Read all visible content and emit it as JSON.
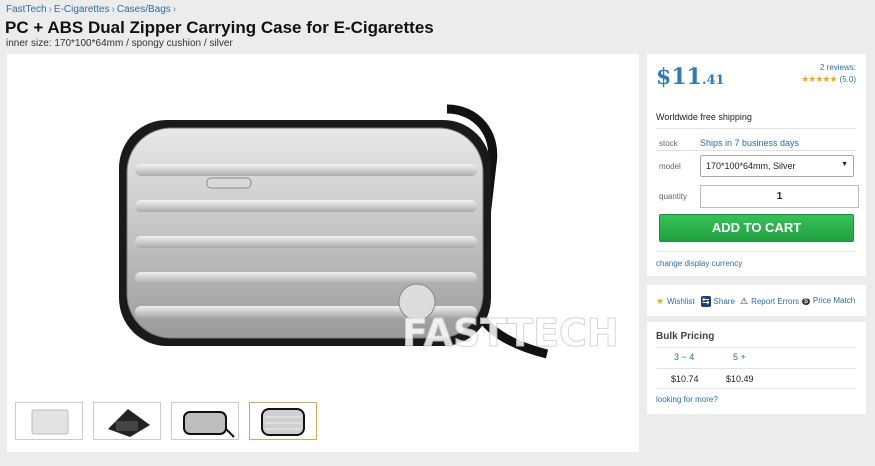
{
  "breadcrumb": [
    "FastTech",
    "E-Cigarettes",
    "Cases/Bags"
  ],
  "breadcrumb_sep": "›",
  "product": {
    "title": "PC + ABS Dual Zipper Carrying Case for E-Cigarettes",
    "subtitle": "inner size: 170*100*64mm / spongy cushion / silver",
    "watermark": "FASTTECH"
  },
  "price": {
    "currency": "$",
    "integer": "11",
    "decimal": ".41"
  },
  "reviews": {
    "label": "2 reviews:",
    "stars": "★★★★★",
    "rating": "(5.0)"
  },
  "shipping": "Worldwide free shipping",
  "stock": {
    "label": "stock",
    "value": "Ships in 7 business days"
  },
  "model": {
    "label": "model",
    "selected": "170*100*64mm, Silver",
    "arrow": "▼"
  },
  "quantity": {
    "label": "quantity",
    "value": "1"
  },
  "add_to_cart": "ADD TO CART",
  "currency_link": "change display currency",
  "actions": [
    {
      "icon": "★",
      "label": "Wishlist"
    },
    {
      "icon": "⇆",
      "label": "Share"
    },
    {
      "icon": "⚠",
      "label": "Report Errors"
    },
    {
      "icon": "$",
      "label": "Price Match"
    }
  ],
  "bulk": {
    "title": "Bulk Pricing",
    "tiers": [
      {
        "qty": "3 ~ 4",
        "price": "$10.74"
      },
      {
        "qty": "5 +",
        "price": "$10.49"
      }
    ],
    "more": "looking for more?"
  },
  "colors": {
    "accent": "#2e7bb5",
    "cart": "#2bb34b",
    "star": "#f0a818"
  }
}
